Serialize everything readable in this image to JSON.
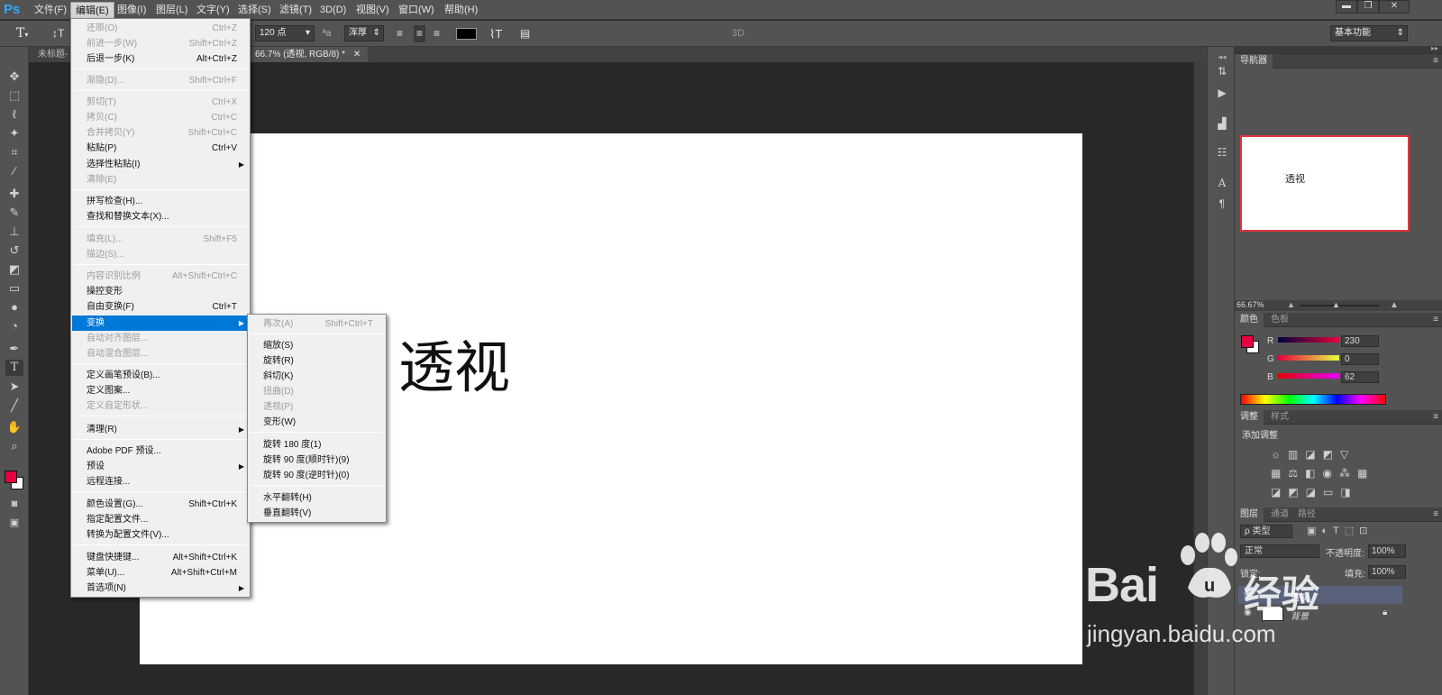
{
  "app": {
    "logo": "Ps"
  },
  "menubar": {
    "items": [
      "文件(F)",
      "编辑(E)",
      "图像(I)",
      "图层(L)",
      "文字(Y)",
      "选择(S)",
      "滤镜(T)",
      "3D(D)",
      "视图(V)",
      "窗口(W)",
      "帮助(H)"
    ],
    "window_buttons": [
      "▬",
      "❐",
      "✕"
    ]
  },
  "optionsbar": {
    "font_size": "120 点",
    "aa_label": "ªa",
    "aa_mode": "浑厚",
    "threed_label": "3D",
    "workspace": "基本功能",
    "text_color": "#000000"
  },
  "tabs": {
    "inactive": "未标题-",
    "active": "66.7% (透视, RGB/8) *"
  },
  "canvas": {
    "text": "透视"
  },
  "edit_menu": [
    {
      "label": "还原(O)",
      "shortcut": "Ctrl+Z",
      "disabled": true
    },
    {
      "label": "前进一步(W)",
      "shortcut": "Shift+Ctrl+Z",
      "disabled": true
    },
    {
      "label": "后退一步(K)",
      "shortcut": "Alt+Ctrl+Z",
      "disabled": false
    },
    {
      "label": "渐隐(D)...",
      "shortcut": "Shift+Ctrl+F",
      "disabled": true
    },
    {
      "label": "剪切(T)",
      "shortcut": "Ctrl+X",
      "disabled": true
    },
    {
      "label": "拷贝(C)",
      "shortcut": "Ctrl+C",
      "disabled": true
    },
    {
      "label": "合并拷贝(Y)",
      "shortcut": "Shift+Ctrl+C",
      "disabled": true
    },
    {
      "label": "粘贴(P)",
      "shortcut": "Ctrl+V",
      "disabled": false
    },
    {
      "label": "选择性粘贴(I)",
      "shortcut": "",
      "disabled": false
    },
    {
      "label": "清除(E)",
      "shortcut": "",
      "disabled": true
    },
    {
      "label": "拼写检查(H)...",
      "shortcut": "",
      "disabled": false
    },
    {
      "label": "查找和替换文本(X)...",
      "shortcut": "",
      "disabled": false
    },
    {
      "label": "填充(L)...",
      "shortcut": "Shift+F5",
      "disabled": true
    },
    {
      "label": "描边(S)...",
      "shortcut": "",
      "disabled": true
    },
    {
      "label": "内容识别比例",
      "shortcut": "Alt+Shift+Ctrl+C",
      "disabled": true
    },
    {
      "label": "操控变形",
      "shortcut": "",
      "disabled": false
    },
    {
      "label": "自由变换(F)",
      "shortcut": "Ctrl+T",
      "disabled": false
    },
    {
      "label": "变换",
      "shortcut": "",
      "disabled": false
    },
    {
      "label": "自动对齐图层...",
      "shortcut": "",
      "disabled": true
    },
    {
      "label": "自动混合图层...",
      "shortcut": "",
      "disabled": true
    },
    {
      "label": "定义画笔预设(B)...",
      "shortcut": "",
      "disabled": false
    },
    {
      "label": "定义图案...",
      "shortcut": "",
      "disabled": false
    },
    {
      "label": "定义自定形状...",
      "shortcut": "",
      "disabled": true
    },
    {
      "label": "清理(R)",
      "shortcut": "",
      "disabled": false
    },
    {
      "label": "Adobe PDF 预设...",
      "shortcut": "",
      "disabled": false
    },
    {
      "label": "预设",
      "shortcut": "",
      "disabled": false
    },
    {
      "label": "远程连接...",
      "shortcut": "",
      "disabled": false
    },
    {
      "label": "颜色设置(G)...",
      "shortcut": "Shift+Ctrl+K",
      "disabled": false
    },
    {
      "label": "指定配置文件...",
      "shortcut": "",
      "disabled": false
    },
    {
      "label": "转换为配置文件(V)...",
      "shortcut": "",
      "disabled": false
    },
    {
      "label": "键盘快捷键...",
      "shortcut": "Alt+Shift+Ctrl+K",
      "disabled": false
    },
    {
      "label": "菜单(U)...",
      "shortcut": "Alt+Shift+Ctrl+M",
      "disabled": false
    },
    {
      "label": "首选项(N)",
      "shortcut": "",
      "disabled": false
    }
  ],
  "transform_menu": [
    {
      "label": "再次(A)",
      "shortcut": "Shift+Ctrl+T",
      "disabled": true
    },
    {
      "label": "缩放(S)",
      "shortcut": "",
      "disabled": false
    },
    {
      "label": "旋转(R)",
      "shortcut": "",
      "disabled": false
    },
    {
      "label": "斜切(K)",
      "shortcut": "",
      "disabled": false
    },
    {
      "label": "扭曲(D)",
      "shortcut": "",
      "disabled": true
    },
    {
      "label": "透视(P)",
      "shortcut": "",
      "disabled": true
    },
    {
      "label": "变形(W)",
      "shortcut": "",
      "disabled": false
    },
    {
      "label": "旋转 180 度(1)",
      "shortcut": "",
      "disabled": false
    },
    {
      "label": "旋转 90 度(顺时针)(9)",
      "shortcut": "",
      "disabled": false
    },
    {
      "label": "旋转 90 度(逆时针)(0)",
      "shortcut": "",
      "disabled": false
    },
    {
      "label": "水平翻转(H)",
      "shortcut": "",
      "disabled": false
    },
    {
      "label": "垂直翻转(V)",
      "shortcut": "",
      "disabled": false
    }
  ],
  "navigator": {
    "tab": "导航器",
    "preview_text": "透视",
    "zoom": "66.67%"
  },
  "color_panel": {
    "tabs": [
      "颜色",
      "色板"
    ],
    "r_label": "R",
    "g_label": "G",
    "b_label": "B",
    "r": "230",
    "g": "0",
    "b": "62",
    "fg_color": "#e6003e"
  },
  "adjust_panel": {
    "tabs": [
      "调整",
      "样式"
    ],
    "title": "添加调整"
  },
  "layers_panel": {
    "tabs": [
      "图层",
      "通道",
      "路径"
    ],
    "filter": "ρ 类型",
    "blend_mode": "正常",
    "opacity_label": "不透明度:",
    "opacity": "100%",
    "lock_label": "锁定:",
    "fill_label": "填充:",
    "fill": "100%",
    "layers": [
      {
        "name": "透视"
      },
      {
        "name": "背景"
      }
    ]
  },
  "watermark": {
    "brand": "Bai",
    "brand_cn": "经验",
    "url": "jingyan.baidu.com"
  }
}
